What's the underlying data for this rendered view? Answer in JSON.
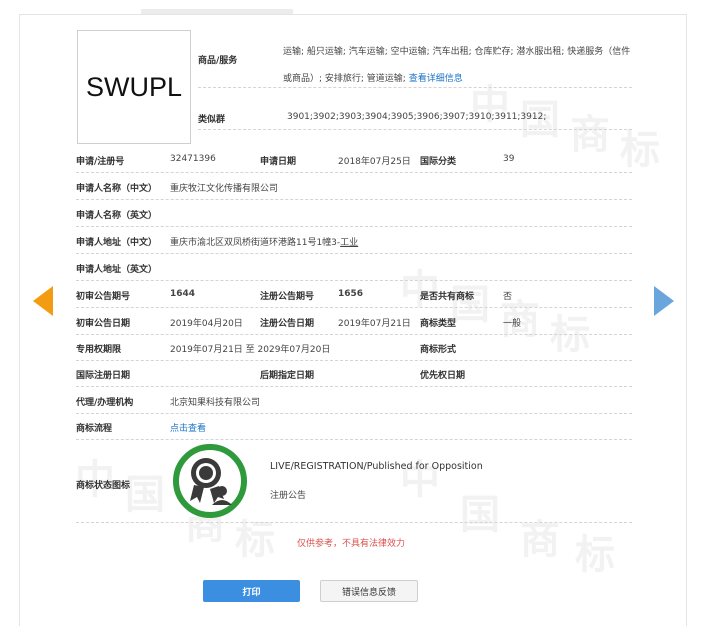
{
  "trademark": {
    "name": "SWUPL"
  },
  "goods": {
    "label": "商品/服务",
    "text": "运输; 船只运输; 汽车运输; 空中运输; 汽车出租; 仓库贮存; 潜水服出租; 快递服务（信件或商品）; 安排旅行; 管道运输; ",
    "link": "查看详细信息"
  },
  "similar_group": {
    "label": "类似群",
    "value": "3901;3902;3903;3904;3905;3906;3907;3910;3911;3912;"
  },
  "reg_number": {
    "label": "申请/注册号",
    "value": "32471396"
  },
  "app_date": {
    "label": "申请日期",
    "value": "2018年07月25日"
  },
  "intl_class": {
    "label": "国际分类",
    "value": "39"
  },
  "applicant_cn": {
    "label": "申请人名称（中文）",
    "value": "重庆牧江文化传播有限公司"
  },
  "applicant_en": {
    "label": "申请人名称（英文）",
    "value": ""
  },
  "address_cn": {
    "label": "申请人地址（中文）",
    "value": "重庆市渝北区双凤桥街道环港路11号1幢3-",
    "value_link": "工业"
  },
  "address_en": {
    "label": "申请人地址（英文）",
    "value": ""
  },
  "prelim_issue": {
    "label": "初审公告期号",
    "value": "1644"
  },
  "reg_issue": {
    "label": "注册公告期号",
    "value": "1656"
  },
  "shared": {
    "label": "是否共有商标",
    "value": "否"
  },
  "prelim_date": {
    "label": "初审公告日期",
    "value": "2019年04月20日"
  },
  "reg_date": {
    "label": "注册公告日期",
    "value": "2019年07月21日"
  },
  "tm_type": {
    "label": "商标类型",
    "value": "一般"
  },
  "exclusive": {
    "label": "专用权期限",
    "value": "2019年07月21日 至 2029年07月20日"
  },
  "tm_form": {
    "label": "商标形式",
    "value": ""
  },
  "intl_reg_date": {
    "label": "国际注册日期",
    "value": ""
  },
  "later_date": {
    "label": "后期指定日期",
    "value": ""
  },
  "priority_date": {
    "label": "优先权日期",
    "value": ""
  },
  "agent": {
    "label": "代理/办理机构",
    "value": "北京知果科技有限公司"
  },
  "process": {
    "label": "商标流程",
    "link": "点击查看"
  },
  "status": {
    "label": "商标状态图标",
    "en": "LIVE/REGISTRATION/Published for Opposition",
    "cn": "注册公告",
    "icon": "registered-trademark-badge-icon"
  },
  "disclaimer": "仅供参考，不具有法律效力",
  "buttons": {
    "print": "打印",
    "feedback": "错误信息反馈"
  },
  "watermarks": [
    "中",
    "国",
    "商",
    "标"
  ],
  "colors": {
    "accent_blue": "#3b8ee0",
    "link_blue": "#1a73c8",
    "arrow_left": "#f39c12",
    "arrow_right": "#6aa5dc",
    "badge_green": "#2e9a3c",
    "disclaimer_red": "#d9534f"
  }
}
